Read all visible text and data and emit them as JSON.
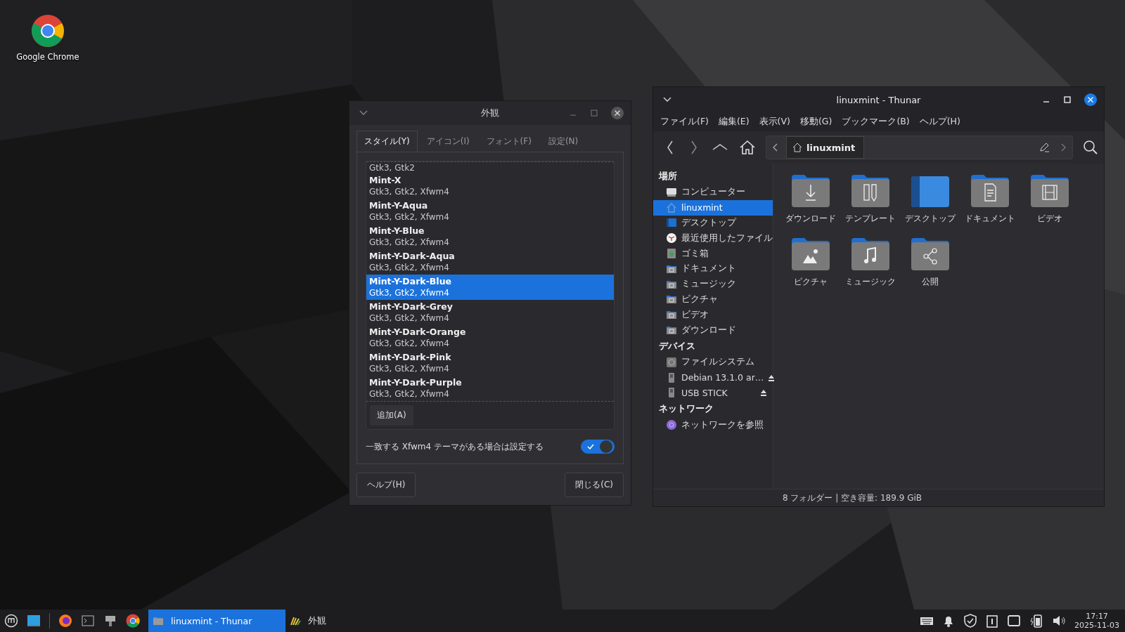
{
  "desktop_icons": [
    {
      "label": "Google Chrome"
    }
  ],
  "appearance_dialog": {
    "title": "外観",
    "tabs": [
      {
        "label": "スタイル(Y)",
        "selected": true
      },
      {
        "label": "アイコン(I)",
        "selected": false
      },
      {
        "label": "フォント(F)",
        "selected": false
      },
      {
        "label": "設定(N)",
        "selected": false
      }
    ],
    "themes": [
      {
        "details": "Gtk3, Gtk2",
        "selected": false
      },
      {
        "name": "Mint-X",
        "details": "Gtk3, Gtk2, Xfwm4",
        "selected": false
      },
      {
        "name": "Mint-Y-Aqua",
        "details": "Gtk3, Gtk2, Xfwm4",
        "selected": false
      },
      {
        "name": "Mint-Y-Blue",
        "details": "Gtk3, Gtk2, Xfwm4",
        "selected": false
      },
      {
        "name": "Mint-Y-Dark-Aqua",
        "details": "Gtk3, Gtk2, Xfwm4",
        "selected": false
      },
      {
        "name": "Mint-Y-Dark-Blue",
        "details": "Gtk3, Gtk2, Xfwm4",
        "selected": true
      },
      {
        "name": "Mint-Y-Dark-Grey",
        "details": "Gtk3, Gtk2, Xfwm4",
        "selected": false
      },
      {
        "name": "Mint-Y-Dark-Orange",
        "details": "Gtk3, Gtk2, Xfwm4",
        "selected": false
      },
      {
        "name": "Mint-Y-Dark-Pink",
        "details": "Gtk3, Gtk2, Xfwm4",
        "selected": false
      },
      {
        "name": "Mint-Y-Dark-Purple",
        "details": "Gtk3, Gtk2, Xfwm4",
        "selected": false
      }
    ],
    "add_button": "追加(A)",
    "match_toggle": {
      "label": "一致する Xfwm4 テーマがある場合は設定する",
      "on": true
    },
    "help_button": "ヘルプ(H)",
    "close_button": "閉じる(C)"
  },
  "file_manager": {
    "title": "linuxmint - Thunar",
    "menu": [
      "ファイル(F)",
      "編集(E)",
      "表示(V)",
      "移動(G)",
      "ブックマーク(B)",
      "ヘルプ(H)"
    ],
    "path_button": "linuxmint",
    "sidebar": [
      {
        "heading": "場所",
        "items": [
          {
            "label": "コンピューター",
            "kind": "computer",
            "selected": false
          },
          {
            "label": "linuxmint",
            "kind": "home",
            "selected": true
          },
          {
            "label": "デスクトップ",
            "kind": "desktop",
            "selected": false
          },
          {
            "label": "最近使用したファイル",
            "kind": "recent",
            "selected": false
          },
          {
            "label": "ゴミ箱",
            "kind": "trash",
            "selected": false
          },
          {
            "label": "ドキュメント",
            "kind": "documents",
            "selected": false
          },
          {
            "label": "ミュージック",
            "kind": "music",
            "selected": false
          },
          {
            "label": "ピクチャ",
            "kind": "pictures",
            "selected": false
          },
          {
            "label": "ビデオ",
            "kind": "videos",
            "selected": false
          },
          {
            "label": "ダウンロード",
            "kind": "download",
            "selected": false
          }
        ]
      },
      {
        "heading": "デバイス",
        "items": [
          {
            "label": "ファイルシステム",
            "kind": "filesystem",
            "selected": false
          },
          {
            "label": "Debian 13.1.0 ar…",
            "kind": "usb",
            "selected": false,
            "ejectable": true
          },
          {
            "label": "USB STICK",
            "kind": "usb",
            "selected": false,
            "ejectable": true
          }
        ]
      },
      {
        "heading": "ネットワーク",
        "items": [
          {
            "label": "ネットワークを参照",
            "kind": "network",
            "selected": false
          }
        ]
      }
    ],
    "folders": [
      {
        "label": "ダウンロード",
        "kind": "download"
      },
      {
        "label": "テンプレート",
        "kind": "templates"
      },
      {
        "label": "デスクトップ",
        "kind": "desktop"
      },
      {
        "label": "ドキュメント",
        "kind": "documents"
      },
      {
        "label": "ビデオ",
        "kind": "videos"
      },
      {
        "label": "ピクチャ",
        "kind": "pictures"
      },
      {
        "label": "ミュージック",
        "kind": "music"
      },
      {
        "label": "公開",
        "kind": "public"
      }
    ],
    "status": "8 フォルダー | 空き容量: 189.9 GiB"
  },
  "taskbar": {
    "tasks": [
      {
        "label": "linuxmint - Thunar",
        "kind": "file-manager",
        "selected": true
      },
      {
        "label": "外観",
        "kind": "appearance",
        "selected": false
      }
    ],
    "time": "17:17",
    "date": "2025-11-03"
  }
}
